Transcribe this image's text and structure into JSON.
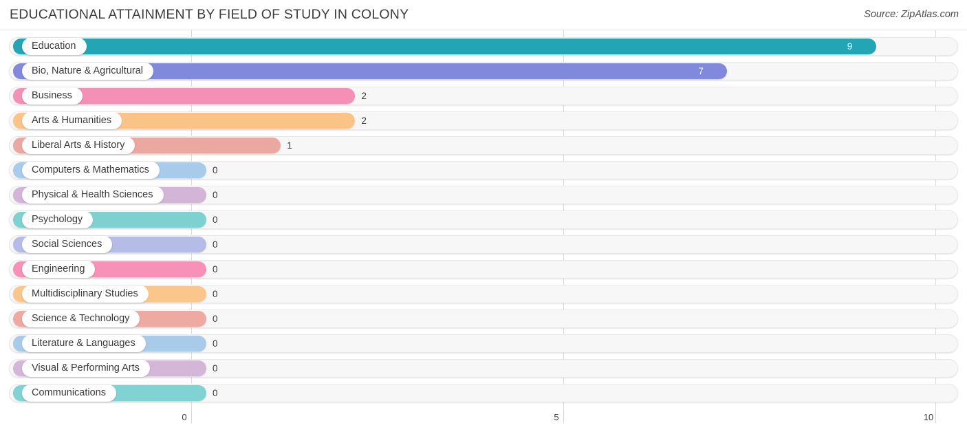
{
  "header": {
    "title": "EDUCATIONAL ATTAINMENT BY FIELD OF STUDY IN COLONY",
    "source": "Source: ZipAtlas.com"
  },
  "chart_data": {
    "type": "bar",
    "orientation": "horizontal",
    "title": "EDUCATIONAL ATTAINMENT BY FIELD OF STUDY IN COLONY",
    "xlabel": "",
    "ylabel": "",
    "xlim": [
      0,
      10
    ],
    "grid": true,
    "legend": "none",
    "xticks": [
      "0",
      "5",
      "10"
    ],
    "xtick_values": [
      0,
      5,
      10
    ],
    "categories": [
      "Education",
      "Bio, Nature & Agricultural",
      "Business",
      "Arts & Humanities",
      "Liberal Arts & History",
      "Computers & Mathematics",
      "Physical & Health Sciences",
      "Psychology",
      "Social Sciences",
      "Engineering",
      "Multidisciplinary Studies",
      "Science & Technology",
      "Literature & Languages",
      "Visual & Performing Arts",
      "Communications"
    ],
    "values": [
      9,
      7,
      2,
      2,
      1,
      0,
      0,
      0,
      0,
      0,
      0,
      0,
      0,
      0,
      0
    ],
    "value_labels": [
      "9",
      "7",
      "2",
      "2",
      "1",
      "0",
      "0",
      "0",
      "0",
      "0",
      "0",
      "0",
      "0",
      "0",
      "0"
    ],
    "colors": [
      "#23a5b5",
      "#8189dc",
      "#f48fb5",
      "#fbc486",
      "#eba8a0",
      "#a8cbeb",
      "#d3b5d8",
      "#7fd1d1",
      "#b5bce8",
      "#f791b7",
      "#fbc68c",
      "#eda9a2",
      "#a9cbea",
      "#d4b6d9",
      "#81d2d2"
    ]
  }
}
